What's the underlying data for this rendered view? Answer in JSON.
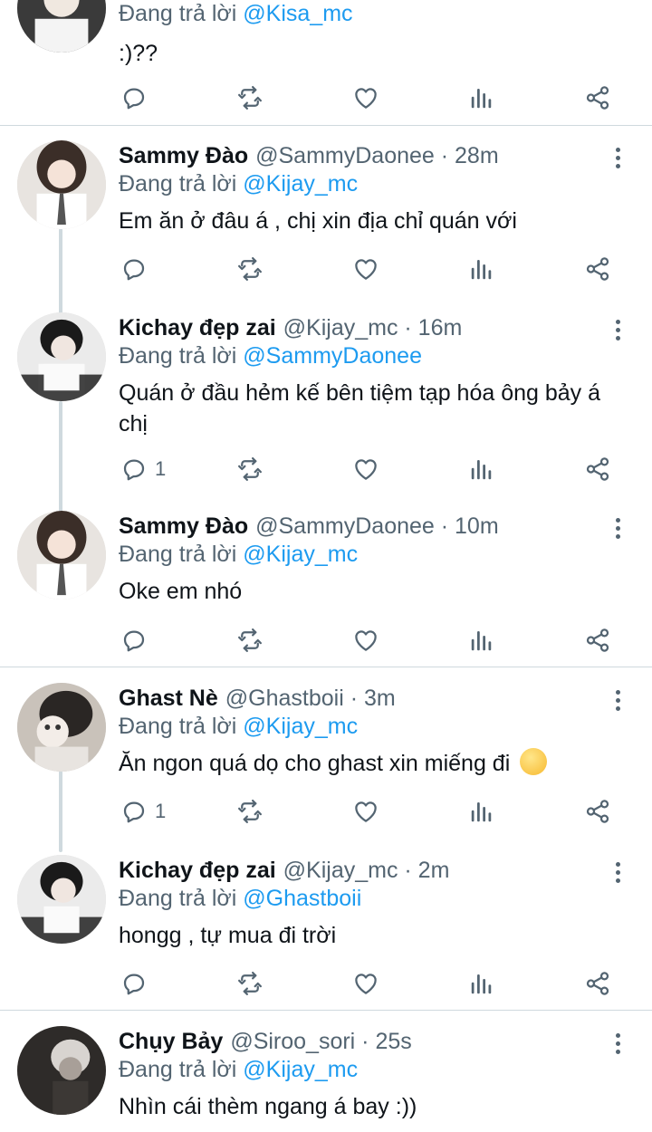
{
  "reply_prefix": "Đang trả lời",
  "tweets": [
    {
      "name": "",
      "handle": "",
      "reply_to": "@Kisa_mc",
      "text": ":)??",
      "reply_count": ""
    },
    {
      "name": "Sammy Đào",
      "handle": "@SammyDaonee · 28m",
      "reply_to": "@Kijay_mc",
      "text": "Em ăn ở đâu á , chị xin địa chỉ quán với",
      "reply_count": ""
    },
    {
      "name": "Kichay đẹp zai",
      "handle": "@Kijay_mc · 16m",
      "reply_to": "@SammyDaonee",
      "text": "Quán ở đầu hẻm kế bên tiệm tạp hóa ông bảy á chị",
      "reply_count": "1"
    },
    {
      "name": "Sammy Đào",
      "handle": "@SammyDaonee · 10m",
      "reply_to": "@Kijay_mc",
      "text": "Oke em nhó",
      "reply_count": ""
    },
    {
      "name": "Ghast Nè",
      "handle": "@Ghastboii · 3m",
      "reply_to": "@Kijay_mc",
      "text": "Ăn ngon quá dọ cho ghast xin miếng đi",
      "reply_count": "1"
    },
    {
      "name": "Kichay đẹp zai",
      "handle": "@Kijay_mc · 2m",
      "reply_to": "@Ghastboii",
      "text": "hongg , tự mua đi trời",
      "reply_count": ""
    },
    {
      "name": "Chụy Bảy",
      "handle": "@Siroo_sori · 25s",
      "reply_to": "@Kijay_mc",
      "text": "Nhìn cái thèm ngang á bay :))",
      "reply_count": ""
    }
  ],
  "icons": [
    "reply-icon",
    "retweet-icon",
    "like-icon",
    "analytics-icon",
    "share-icon",
    "more-icon",
    "smiling-face-emoji"
  ],
  "colors": {
    "mention": "#1d9bf0",
    "secondary_text": "#536471",
    "divider": "#cfd9de"
  }
}
